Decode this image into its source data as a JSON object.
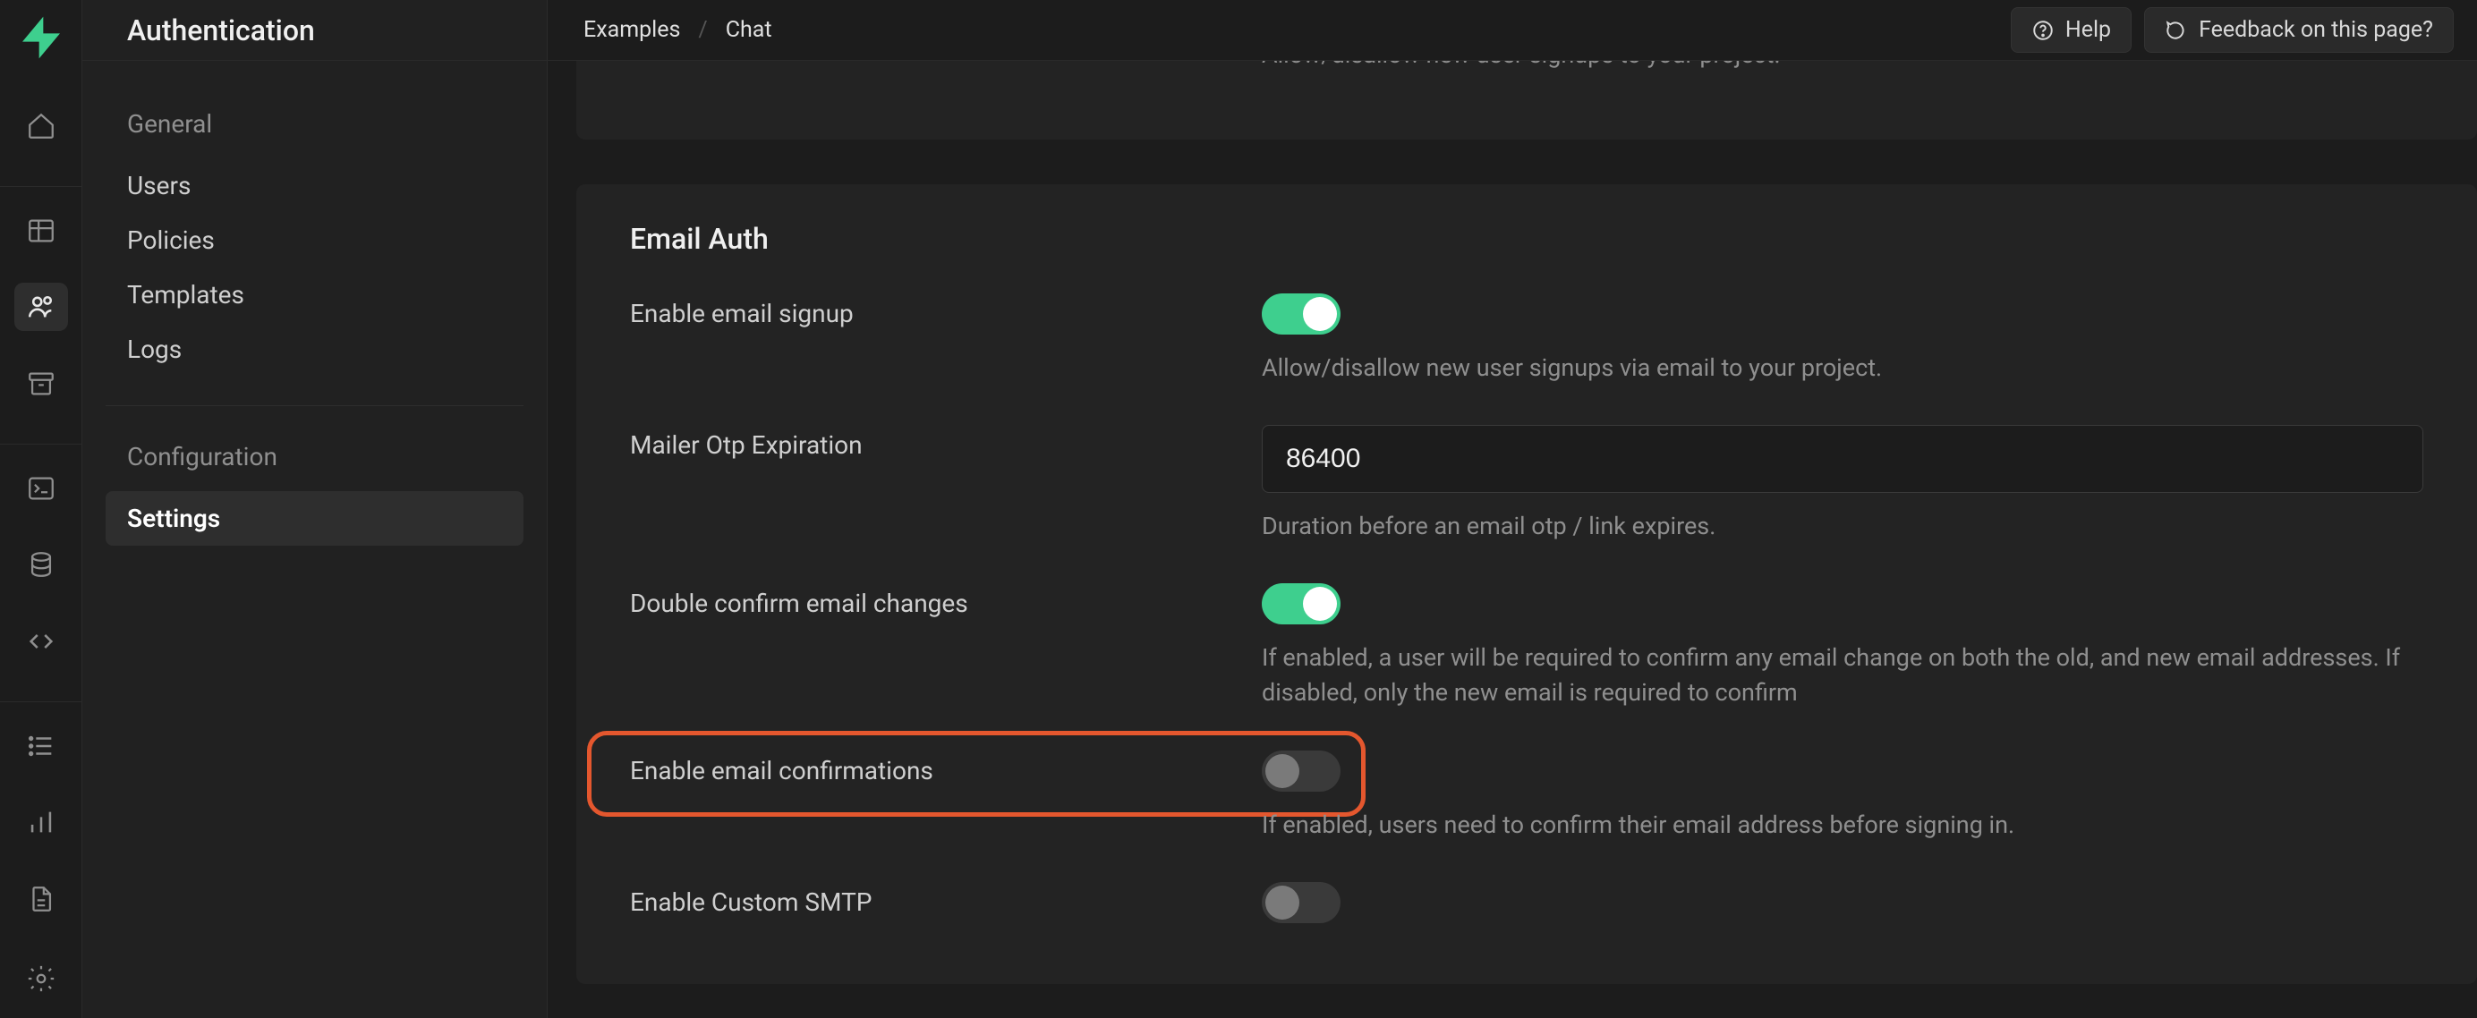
{
  "sidebar": {
    "title": "Authentication",
    "groups": [
      {
        "heading": "General",
        "items": [
          {
            "label": "Users",
            "active": false
          },
          {
            "label": "Policies",
            "active": false
          },
          {
            "label": "Templates",
            "active": false
          },
          {
            "label": "Logs",
            "active": false
          }
        ]
      },
      {
        "heading": "Configuration",
        "items": [
          {
            "label": "Settings",
            "active": true
          }
        ]
      }
    ]
  },
  "breadcrumb": {
    "item1": "Examples",
    "sep": "/",
    "item2": "Chat"
  },
  "topbar": {
    "help_label": "Help",
    "feedback_label": "Feedback on this page?"
  },
  "cards": {
    "signups": {
      "desc_partial": "Allow/disallow new user signups to your project."
    },
    "email_auth": {
      "title": "Email Auth",
      "enable_email_signup": {
        "label": "Enable email signup",
        "desc": "Allow/disallow new user signups via email to your project.",
        "on": true
      },
      "mailer_otp_expiration": {
        "label": "Mailer Otp Expiration",
        "value": "86400",
        "desc": "Duration before an email otp / link expires."
      },
      "double_confirm": {
        "label": "Double confirm email changes",
        "desc": "If enabled, a user will be required to confirm any email change on both the old, and new email addresses. If disabled, only the new email is required to confirm",
        "on": true
      },
      "enable_email_confirmations": {
        "label": "Enable email confirmations",
        "desc": "If enabled, users need to confirm their email address before signing in.",
        "on": false
      },
      "enable_custom_smtp": {
        "label": "Enable Custom SMTP",
        "on": false
      }
    }
  }
}
